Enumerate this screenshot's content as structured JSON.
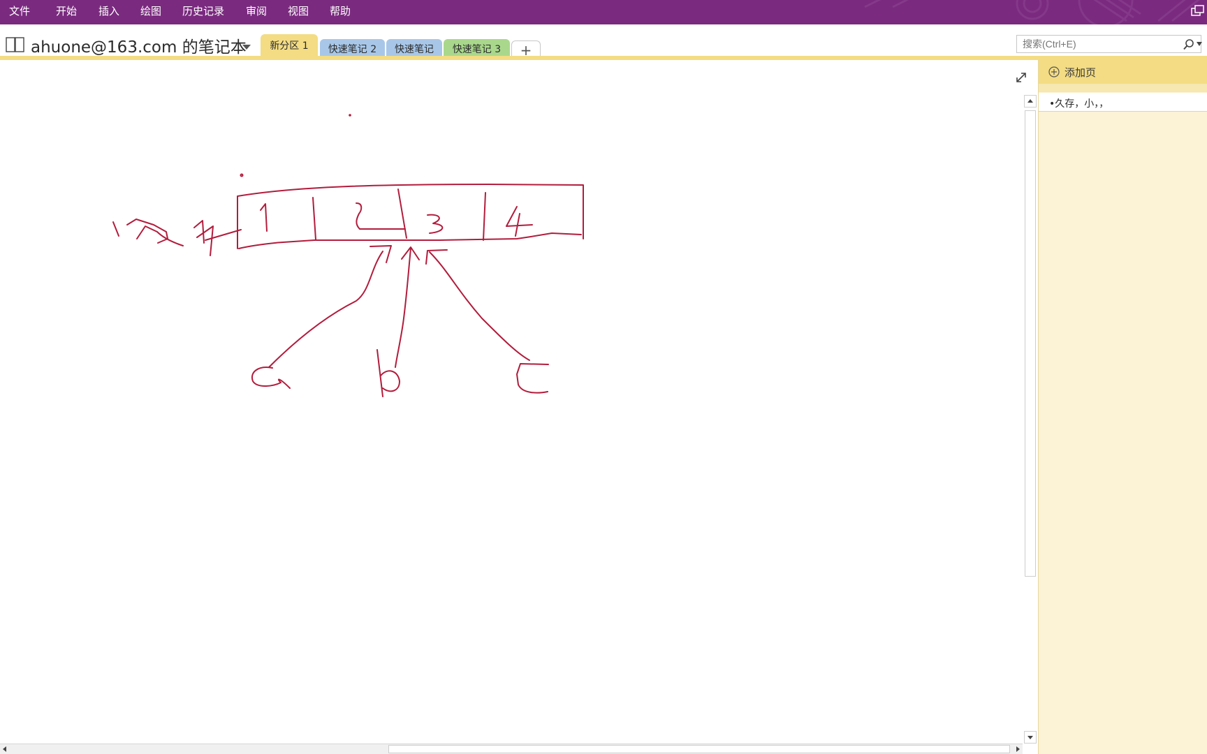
{
  "menu": {
    "items": [
      "文件",
      "开始",
      "插入",
      "绘图",
      "历史记录",
      "审阅",
      "视图",
      "帮助"
    ]
  },
  "notebook": {
    "title": "ahuone@163.com 的笔记本"
  },
  "sections": {
    "tabs": [
      "新分区 1",
      "快速笔记 2",
      "快速笔记",
      "快速笔记 3"
    ],
    "add_label": "+"
  },
  "search": {
    "placeholder": "搜索(Ctrl+E)"
  },
  "pages": {
    "add_label": "添加页",
    "items": [
      "•久存，小，，"
    ]
  },
  "drawing": {
    "cell_labels": [
      "1",
      "2",
      "3",
      "4"
    ],
    "pointer_labels": [
      "a",
      "b",
      "c"
    ],
    "side_label": "内存"
  },
  "colors": {
    "menubar": "#7a2a7f",
    "ink": "#b21c3c",
    "active_section": "#f3dc83",
    "blue_section": "#a8c7e8",
    "green_section": "#a9d88c",
    "pages_panel": "#fcf3d6"
  },
  "icons": {
    "notebook": "notebook-icon",
    "dropdown": "chevron-down-icon",
    "search": "search-icon",
    "expand": "expand-icon",
    "add_page": "plus-circle-icon",
    "restore": "window-restore-icon"
  }
}
